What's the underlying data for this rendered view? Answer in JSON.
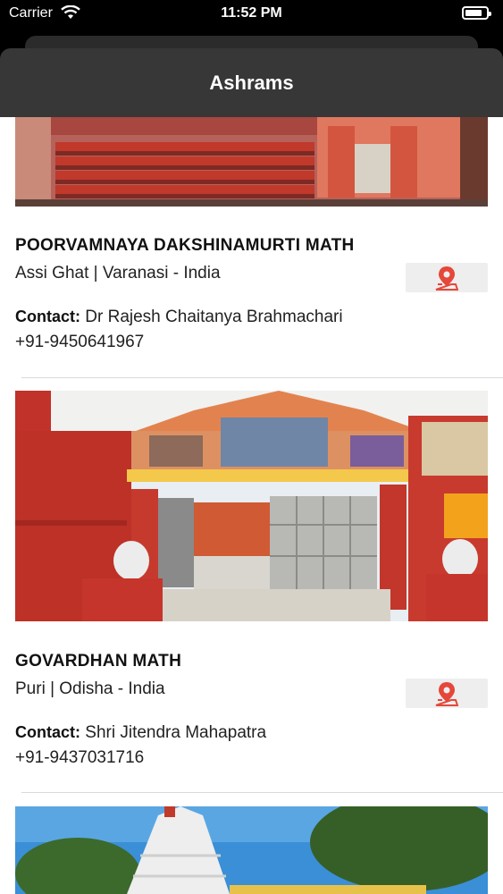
{
  "status_bar": {
    "carrier": "Carrier",
    "time": "11:52 PM"
  },
  "nav": {
    "title": "Ashrams"
  },
  "ashrams": [
    {
      "name": "POORVAMNAYA DAKSHINAMURTI MATH",
      "location": "Assi Ghat | Varanasi - India",
      "contact_label": "Contact:",
      "contact_name": "Dr Rajesh Chaitanya Brahmachari",
      "phone": "+91-9450641967"
    },
    {
      "name": "GOVARDHAN MATH",
      "location": "Puri | Odisha - India",
      "contact_label": "Contact:",
      "contact_name": "Shri Jitendra Mahapatra",
      "phone": "+91-9437031716"
    }
  ],
  "colors": {
    "nav_background": "#373737",
    "map_pin": "#e5473a",
    "map_button_background": "#eeeeee"
  }
}
